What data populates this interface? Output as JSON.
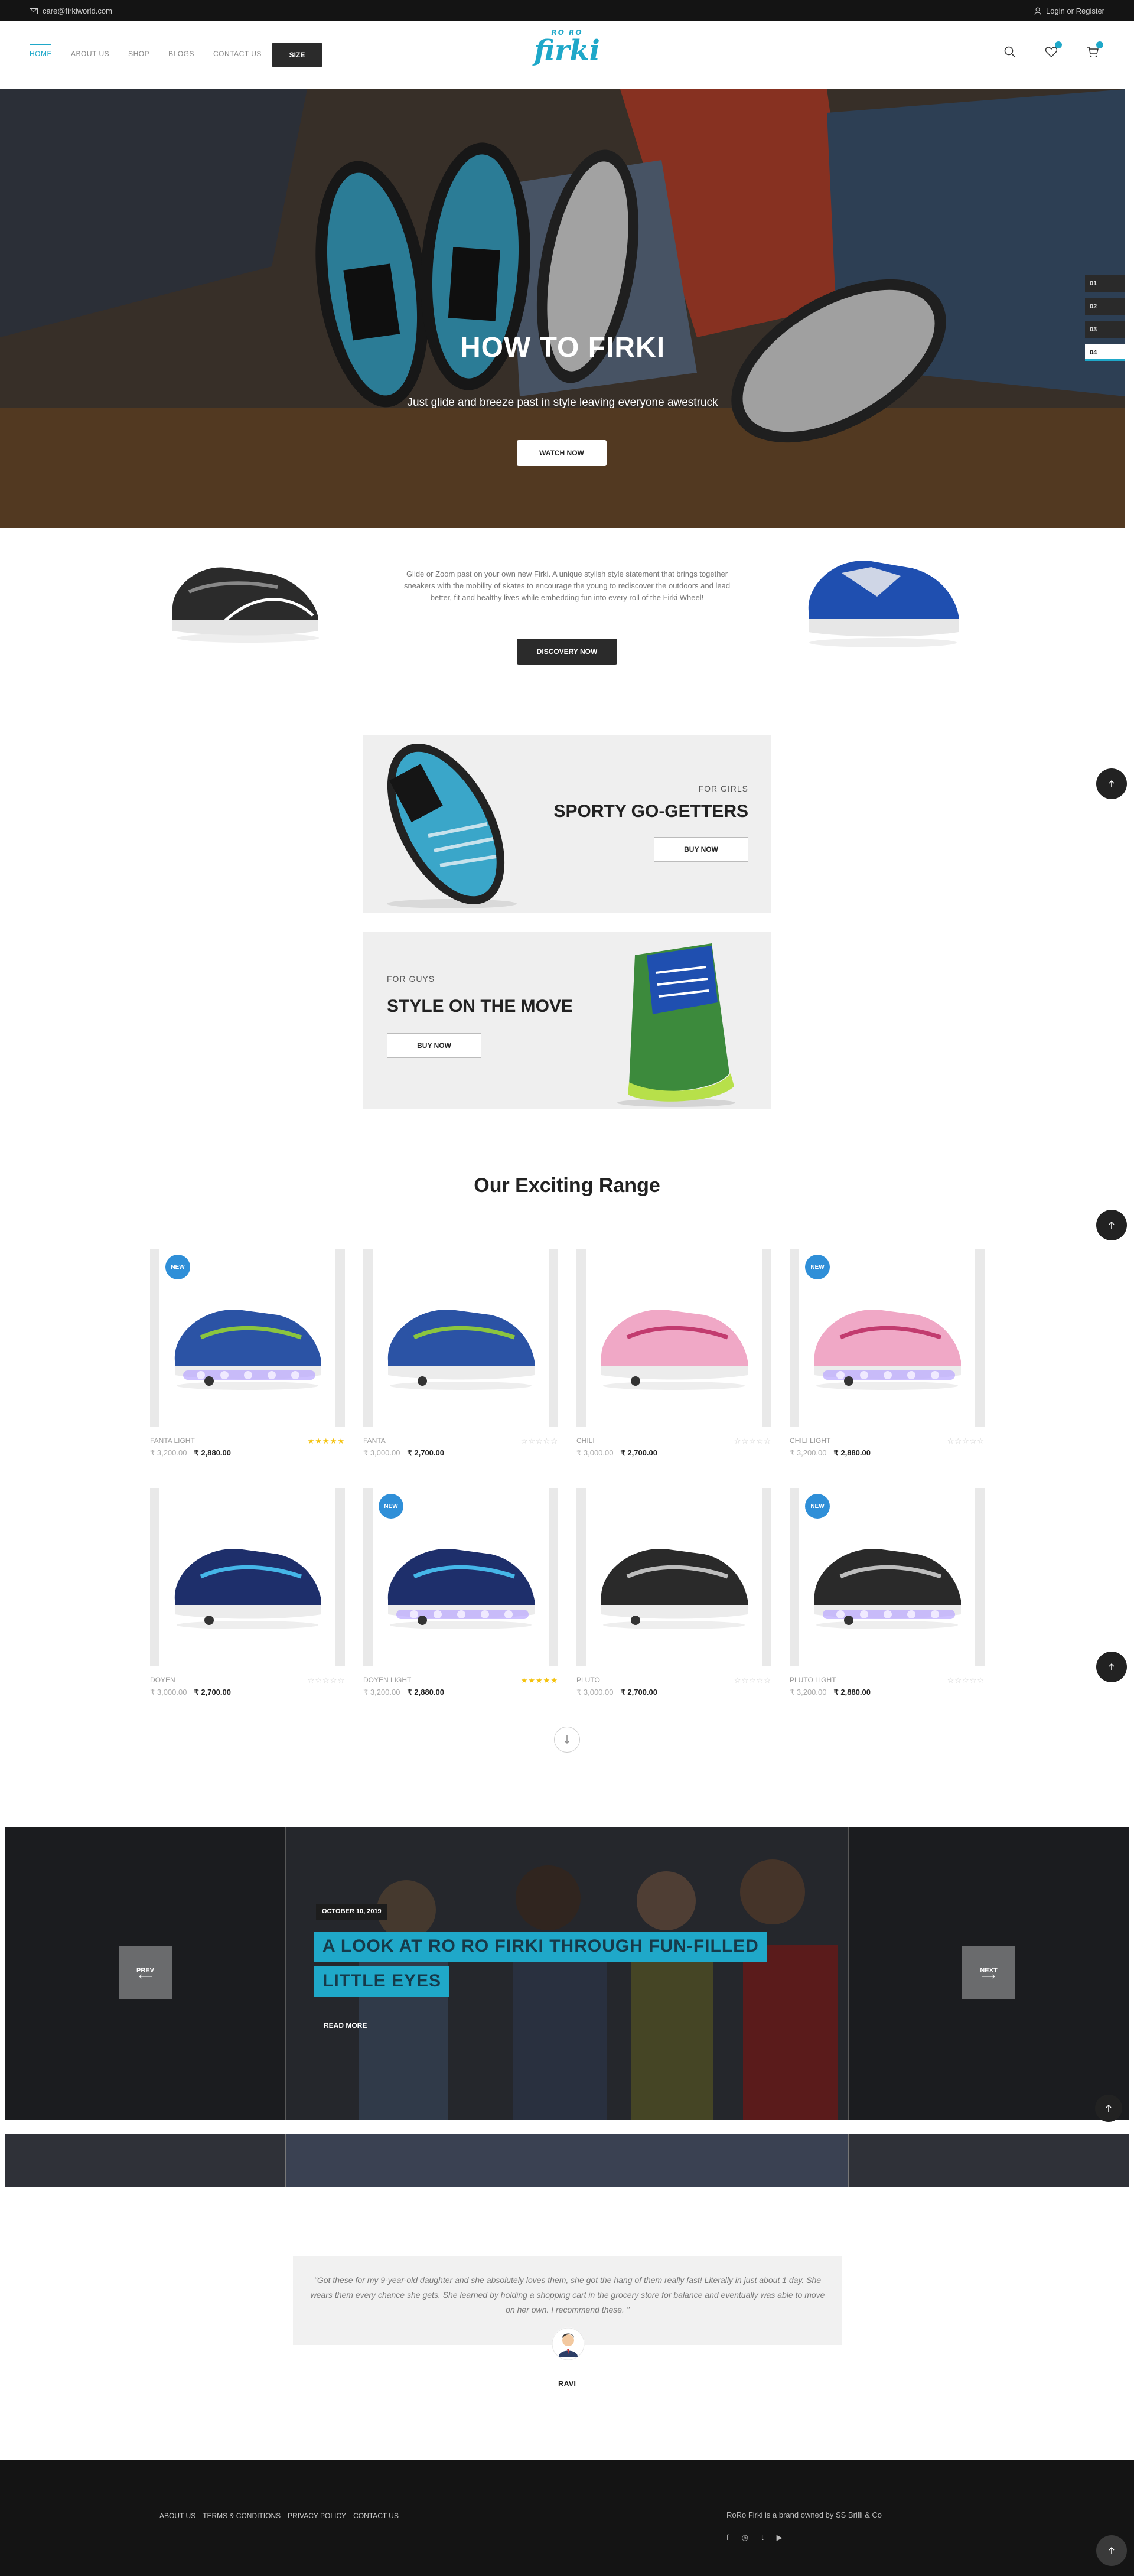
{
  "topbar": {
    "email": "care@firkiworld.com",
    "login": "Login or Register"
  },
  "header": {
    "nav": [
      "HOME",
      "ABOUT US",
      "SHOP",
      "BLOGS",
      "CONTACT US"
    ],
    "size_label": "SIZE",
    "logo_top": "RO RO",
    "logo_main": "firki"
  },
  "hero": {
    "title": "HOW TO FIRKI",
    "subtitle": "Just glide and breeze past in style leaving everyone awestruck",
    "button": "WATCH NOW",
    "slides": [
      "01",
      "02",
      "03",
      "04"
    ]
  },
  "intro": {
    "text": "Glide or Zoom past on your own new Firki. A unique stylish style statement that brings together sneakers with the mobility of skates to encourage the young to rediscover the outdoors and lead better, fit and healthy lives while embedding fun into every roll of the Firki Wheel!",
    "button": "DISCOVERY NOW"
  },
  "promos": {
    "girls": {
      "tag": "FOR GIRLS",
      "title": "SPORTY GO-GETTERS",
      "button": "BUY NOW"
    },
    "guys": {
      "tag": "FOR GUYS",
      "title": "STYLE ON THE MOVE",
      "button": "BUY NOW"
    }
  },
  "range": {
    "title": "Our Exciting Range",
    "new_label": "NEW",
    "products": [
      {
        "name": "FANTA LIGHT",
        "old": "₹ 3,200.00",
        "price": "₹ 2,880.00",
        "rated": true,
        "is_new": true,
        "upper": "#2b53a5",
        "accent": "#8bc53f",
        "lights": true
      },
      {
        "name": "FANTA",
        "old": "₹ 3,000.00",
        "price": "₹ 2,700.00",
        "rated": false,
        "is_new": false,
        "upper": "#2b53a5",
        "accent": "#8bc53f",
        "lights": false
      },
      {
        "name": "CHILI",
        "old": "₹ 3,000.00",
        "price": "₹ 2,700.00",
        "rated": false,
        "is_new": false,
        "upper": "#f0a8c6",
        "accent": "#c23b6f",
        "lights": false
      },
      {
        "name": "CHILI LIGHT",
        "old": "₹ 3,200.00",
        "price": "₹ 2,880.00",
        "rated": false,
        "is_new": true,
        "upper": "#f0a8c6",
        "accent": "#c23b6f",
        "lights": true
      },
      {
        "name": "DOYEN",
        "old": "₹ 3,000.00",
        "price": "₹ 2,700.00",
        "rated": false,
        "is_new": false,
        "upper": "#1e2f6b",
        "accent": "#45b6e8",
        "lights": false
      },
      {
        "name": "DOYEN LIGHT",
        "old": "₹ 3,200.00",
        "price": "₹ 2,880.00",
        "rated": true,
        "is_new": true,
        "upper": "#1e2f6b",
        "accent": "#45b6e8",
        "lights": true
      },
      {
        "name": "PLUTO",
        "old": "₹ 3,000.00",
        "price": "₹ 2,700.00",
        "rated": false,
        "is_new": false,
        "upper": "#2a2a2a",
        "accent": "#bdbdbd",
        "lights": false
      },
      {
        "name": "PLUTO LIGHT",
        "old": "₹ 3,200.00",
        "price": "₹ 2,880.00",
        "rated": false,
        "is_new": true,
        "upper": "#2a2a2a",
        "accent": "#bdbdbd",
        "lights": true
      }
    ]
  },
  "blog": {
    "date": "OCTOBER 10, 2019",
    "title_line1": "A LOOK AT RO RO FIRKI THROUGH FUN-FILLED",
    "title_line2": "LITTLE EYES",
    "read_more": "READ MORE",
    "prev": "PREV",
    "next": "NEXT"
  },
  "testimonial": {
    "quote": "\"Got these for my 9-year-old daughter and she absolutely loves them, she got the hang of them really fast! Literally in just about 1 day. She wears them every chance she gets. She learned by holding a shopping cart in the grocery store for balance and eventually was able to move on her own. I recommend these. \"",
    "name": "RAVI"
  },
  "footer": {
    "links": [
      "ABOUT US",
      "TERMS & CONDITIONS",
      "PRIVACY POLICY",
      "CONTACT US"
    ],
    "owner": "RoRo Firki is a brand owned by SS Brilli & Co",
    "social": [
      "f",
      "◎",
      "t",
      "▶"
    ]
  },
  "colors": {
    "accent": "#1fa8c9",
    "dark": "#141414",
    "new_badge": "#2f8fd8",
    "star": "#f4c20d"
  }
}
